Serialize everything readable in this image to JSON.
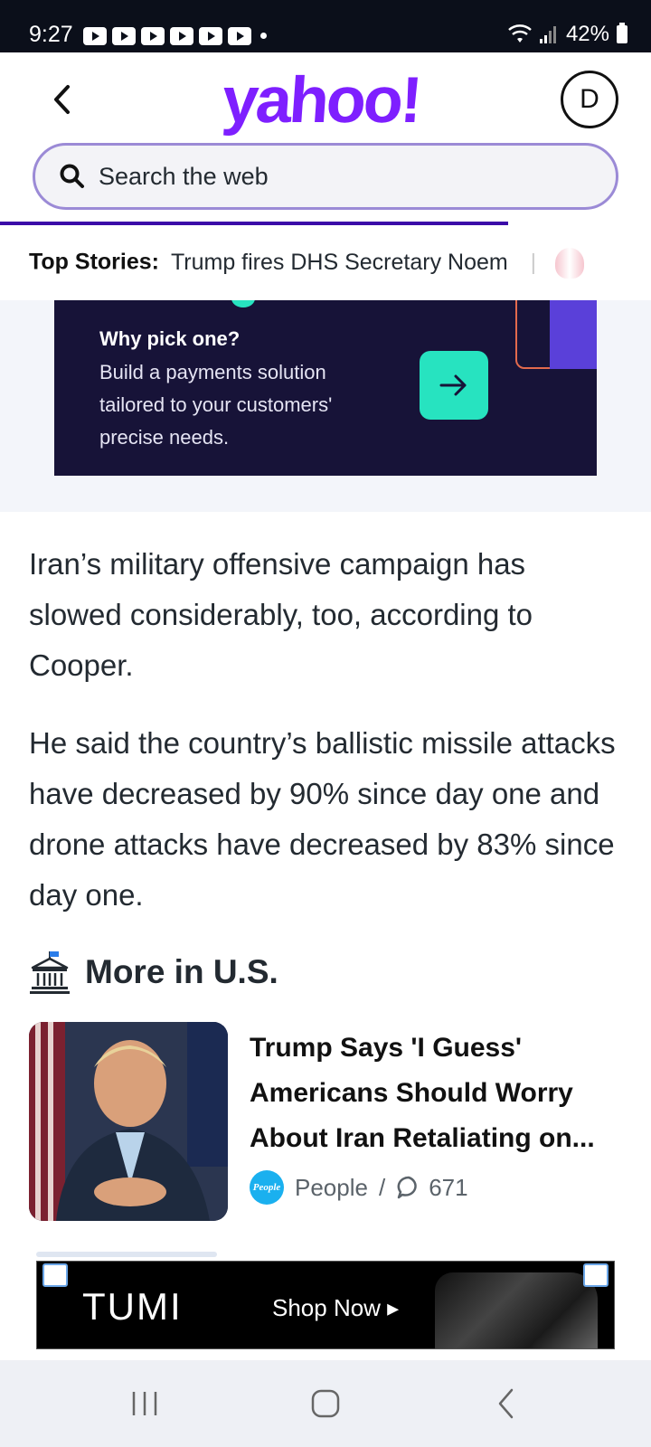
{
  "status_bar": {
    "time": "9:27",
    "battery": "42%"
  },
  "header": {
    "logo": "yahoo!",
    "avatar_initial": "D",
    "search_placeholder": "Search the web",
    "progress_fraction": 0.78
  },
  "top_stories": {
    "label": "Top Stories:",
    "item": "Trump fires DHS Secretary Noem",
    "separator": "|"
  },
  "ad": {
    "title": "Why pick one?",
    "body": "Build a payments solution tailored to your customers' precise needs."
  },
  "article": {
    "paragraphs": [
      "Iran’s military offensive campaign has slowed considerably, too, according to Cooper.",
      "He said the country’s ballistic missile attacks have decreased by 90% since day one and drone attacks have decreased by 83% since day one."
    ]
  },
  "more_section": {
    "title": "More in U.S.",
    "story": {
      "title": "Trump Says 'I Guess' Americans Should Worry About Iran Retaliating on...",
      "source_badge": "People",
      "source": "People",
      "separator": "/",
      "comments": "671"
    }
  },
  "bottom_ad": {
    "brand": "TUMI",
    "cta": "Shop Now ▸"
  },
  "icons": {
    "status": [
      "play-icon",
      "wifi-icon",
      "signal-icon",
      "battery-icon"
    ],
    "header": [
      "back-chevron-icon",
      "search-icon"
    ],
    "section": "government-building-icon",
    "nav": [
      "recent-apps-icon",
      "home-icon",
      "back-icon"
    ]
  },
  "colors": {
    "brand": "#7e1fff",
    "search_border": "#9b8ad6",
    "progress": "#3b0aa8",
    "ad_background": "#171338",
    "ad_accent": "#27e3c0"
  }
}
